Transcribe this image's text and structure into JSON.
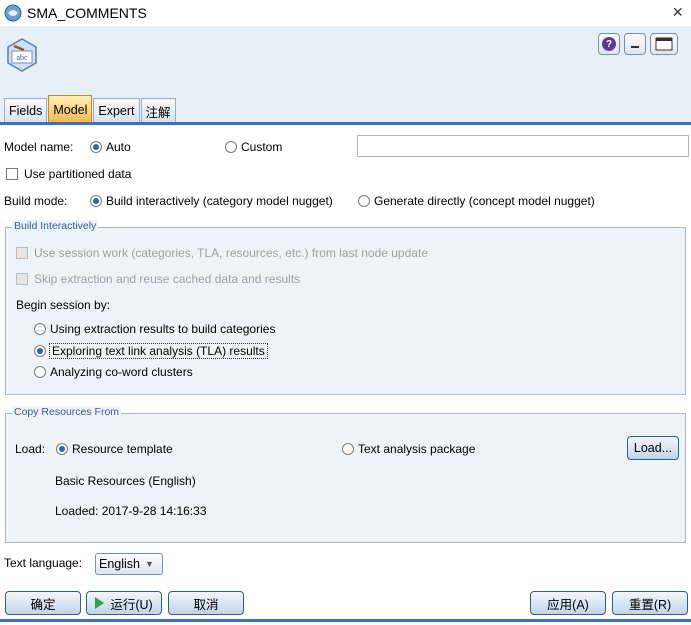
{
  "window": {
    "title": "SMA_COMMENTS",
    "close_label": "×"
  },
  "header": {
    "node_icon_text": "abc",
    "help_label": "?",
    "tabs": [
      {
        "label": "Fields"
      },
      {
        "label": "Model"
      },
      {
        "label": "Expert"
      },
      {
        "label": "注解"
      }
    ]
  },
  "model": {
    "name_label": "Model name:",
    "auto_label": "Auto",
    "custom_label": "Custom",
    "name_value": "",
    "partitioned_label": "Use partitioned data",
    "build_mode_label": "Build mode:",
    "build_interactive_label": "Build interactively (category model nugget)",
    "generate_directly_label": "Generate directly (concept model nugget)"
  },
  "build_interactively": {
    "legend": "Build Interactively",
    "use_session_label": "Use session work (categories, TLA, resources, etc.) from last node update",
    "skip_extraction_label": "Skip extraction and reuse cached data and results",
    "begin_label": "Begin session by:",
    "options": [
      "Using extraction results to build categories",
      "Exploring text link analysis (TLA) results",
      "Analyzing co-word clusters"
    ],
    "selected_index": 1
  },
  "copy_resources": {
    "legend": "Copy Resources From",
    "load_label": "Load:",
    "resource_template_label": "Resource template",
    "text_package_label": "Text analysis package",
    "load_button": "Load...",
    "resource_name": "Basic Resources (English)",
    "loaded_label": "Loaded:",
    "loaded_value": "2017-9-28 14:16:33"
  },
  "language": {
    "label": "Text language:",
    "value": "English"
  },
  "footer": {
    "ok": "确定",
    "run": "运行(U)",
    "cancel": "取消",
    "apply": "应用(A)",
    "reset": "重置(R)"
  },
  "colors": {
    "accent": "#3b72b8",
    "tab_active": "#f5b74a",
    "group_bg": "#eef3f8"
  }
}
